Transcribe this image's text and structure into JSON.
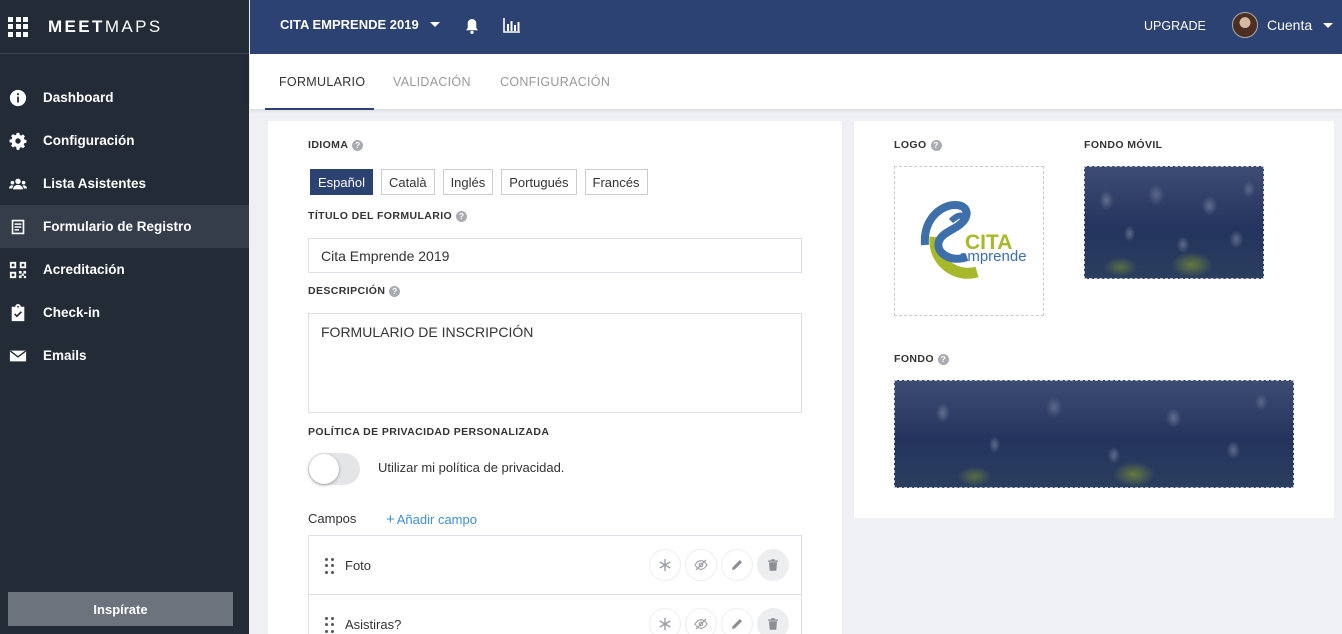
{
  "brand": {
    "bold": "MEET",
    "light": "MAPS"
  },
  "sidebar": {
    "items": [
      {
        "label": "Dashboard",
        "icon": "info-icon"
      },
      {
        "label": "Configuración",
        "icon": "gear-icon"
      },
      {
        "label": "Lista Asistentes",
        "icon": "users-icon"
      },
      {
        "label": "Formulario de Registro",
        "icon": "form-icon",
        "active": true
      },
      {
        "label": "Acreditación",
        "icon": "qr-code-icon"
      },
      {
        "label": "Check-in",
        "icon": "clipboard-check-icon"
      },
      {
        "label": "Emails",
        "icon": "envelope-icon"
      }
    ],
    "inspire_label": "Inspírate"
  },
  "topbar": {
    "event_name": "CITA EMPRENDE 2019",
    "upgrade_label": "UPGRADE",
    "account_label": "Cuenta"
  },
  "tabs": [
    {
      "label": "FORMULARIO",
      "active": true
    },
    {
      "label": "VALIDACIÓN"
    },
    {
      "label": "CONFIGURACIÓN"
    }
  ],
  "form": {
    "language_label": "IDIOMA",
    "languages": [
      {
        "label": "Español",
        "active": true
      },
      {
        "label": "Català"
      },
      {
        "label": "Inglés"
      },
      {
        "label": "Portugués"
      },
      {
        "label": "Francés"
      }
    ],
    "title_label": "TÍTULO DEL FORMULARIO",
    "title_value": "Cita Emprende 2019",
    "description_label": "DESCRIPCIÓN",
    "description_value": "FORMULARIO DE INSCRIPCIÓN",
    "privacy_label": "POLÍTICA DE PRIVACIDAD PERSONALIZADA",
    "privacy_toggle_label": "Utilizar mi política de privacidad.",
    "privacy_enabled": false,
    "fields_label": "Campos",
    "add_field_label": "Añadir campo",
    "fields": [
      {
        "name": "Foto"
      },
      {
        "name": "Asistiras?"
      }
    ]
  },
  "media": {
    "logo_label": "LOGO",
    "mobile_bg_label": "FONDO MÓVIL",
    "bg_label": "FONDO",
    "logo_text_top": "CITA",
    "logo_text_bottom": "emprende"
  },
  "colors": {
    "sidebar_bg": "#232b37",
    "topbar_bg": "#2c4272",
    "accent_link": "#3f8fcf",
    "logo_blue": "#3d6faa",
    "logo_green": "#a7b92a"
  }
}
